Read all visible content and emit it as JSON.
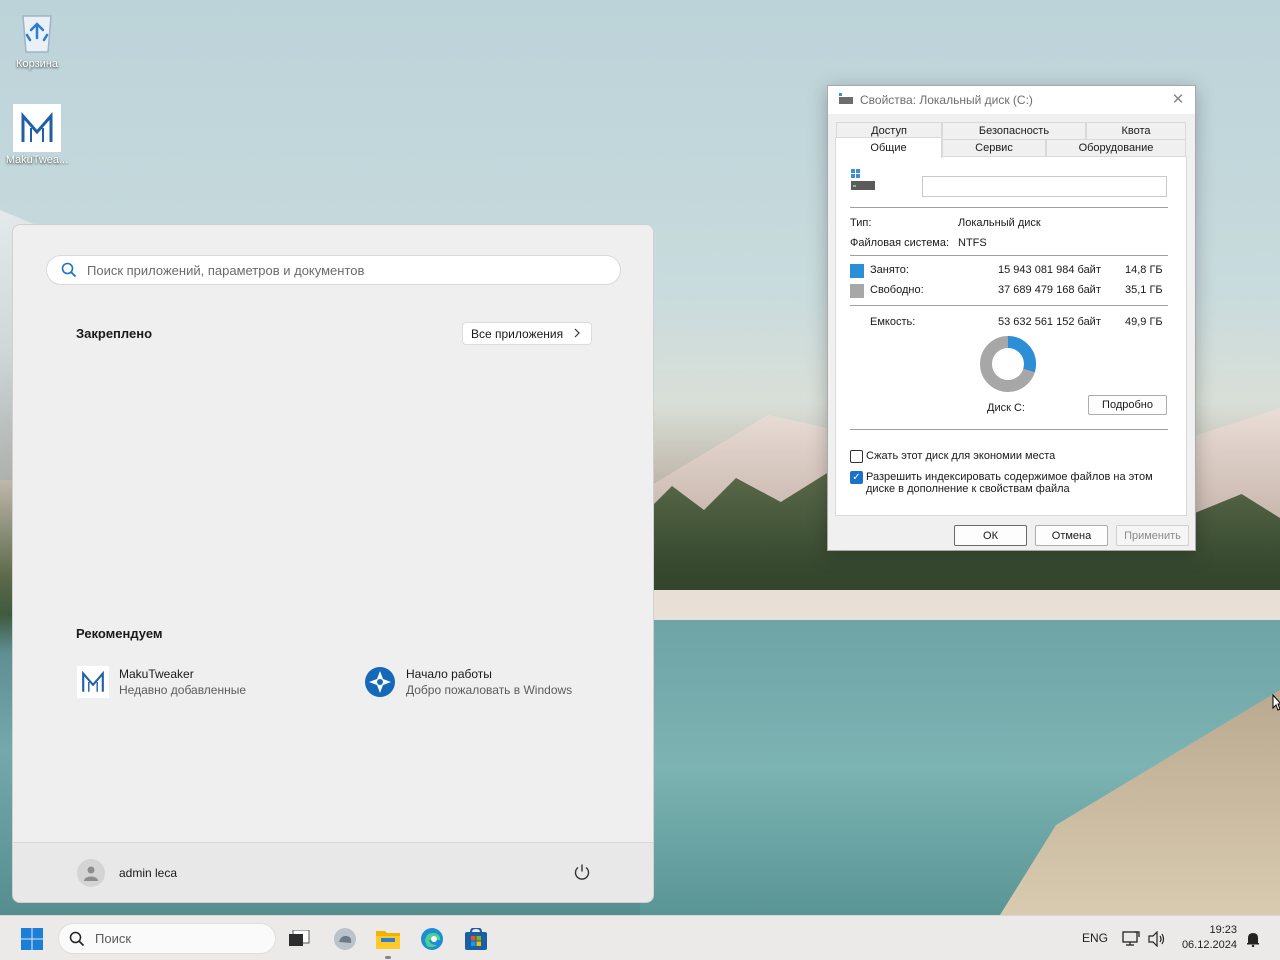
{
  "desktop": {
    "icons": [
      {
        "label": "Корзина"
      },
      {
        "label": "MakuTwea..."
      }
    ]
  },
  "start_menu": {
    "search_placeholder": "Поиск приложений, параметров и документов",
    "pinned_title": "Закреплено",
    "all_apps_label": "Все приложения",
    "recommended_title": "Рекомендуем",
    "recommended": [
      {
        "title": "MakuTweaker",
        "subtitle": "Недавно добавленные"
      },
      {
        "title": "Начало работы",
        "subtitle": "Добро пожаловать в Windows"
      }
    ],
    "user_name": "admin leca"
  },
  "dialog": {
    "title": "Свойства: Локальный диск (C:)",
    "tabs_top": [
      "Доступ",
      "Безопасность",
      "Квота"
    ],
    "tabs_bottom": [
      "Общие",
      "Сервис",
      "Оборудование"
    ],
    "active_tab": "Общие",
    "name_value": "",
    "type_label": "Тип:",
    "type_value": "Локальный диск",
    "fs_label": "Файловая система:",
    "fs_value": "NTFS",
    "used_label": "Занято:",
    "used_bytes": "15 943 081 984 байт",
    "used_gb": "14,8 ГБ",
    "free_label": "Свободно:",
    "free_bytes": "37 689 479 168 байт",
    "free_gb": "35,1 ГБ",
    "capacity_label": "Емкость:",
    "capacity_bytes": "53 632 561 152 байт",
    "capacity_gb": "49,9 ГБ",
    "used_fraction": 0.297,
    "disk_label": "Диск C:",
    "details_button": "Подробно",
    "compress_label": "Сжать этот диск для экономии места",
    "compress_checked": false,
    "index_label_line1": "Разрешить индексировать содержимое файлов на этом",
    "index_label_line2": "диске в дополнение к свойствам файла",
    "index_checked": true,
    "ok_button": "ОК",
    "cancel_button": "Отмена",
    "apply_button": "Применить",
    "colors": {
      "used": "#2a8fd6",
      "free": "#a7a7a7"
    }
  },
  "taskbar": {
    "search_placeholder": "Поиск",
    "language": "ENG",
    "time": "19:23",
    "date": "06.12.2024"
  }
}
